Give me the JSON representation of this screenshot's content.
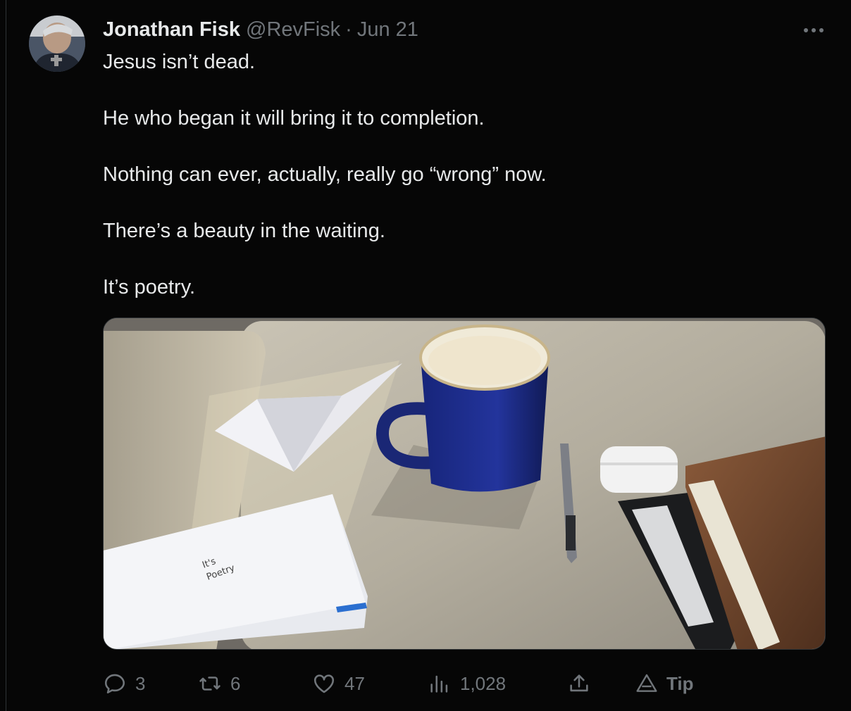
{
  "tweet": {
    "author_name": "Jonathan Fisk",
    "handle": "@RevFisk",
    "separator": "·",
    "date": "Jun 21",
    "more_icon": "more-horizontal-icon",
    "paragraphs": [
      "Jesus isn’t dead.",
      "He who began it will bring it to completion.",
      "Nothing can ever, actually, really go “wrong” now.",
      "There’s a beauty in the waiting.",
      "It’s poetry."
    ],
    "photo": {
      "envelope_text_line1": "It's",
      "envelope_text_line2": "Poetry"
    }
  },
  "actions": {
    "reply": {
      "icon": "reply-icon",
      "count": "3"
    },
    "retweet": {
      "icon": "retweet-icon",
      "count": "6"
    },
    "like": {
      "icon": "heart-icon",
      "count": "47"
    },
    "views": {
      "icon": "views-chart-icon",
      "count": "1,028"
    },
    "share": {
      "icon": "share-icon"
    },
    "tip": {
      "icon": "tip-icon",
      "label": "Tip"
    }
  },
  "colors": {
    "background": "#060606",
    "text_primary": "#e7e9ea",
    "text_secondary": "#71767b"
  }
}
